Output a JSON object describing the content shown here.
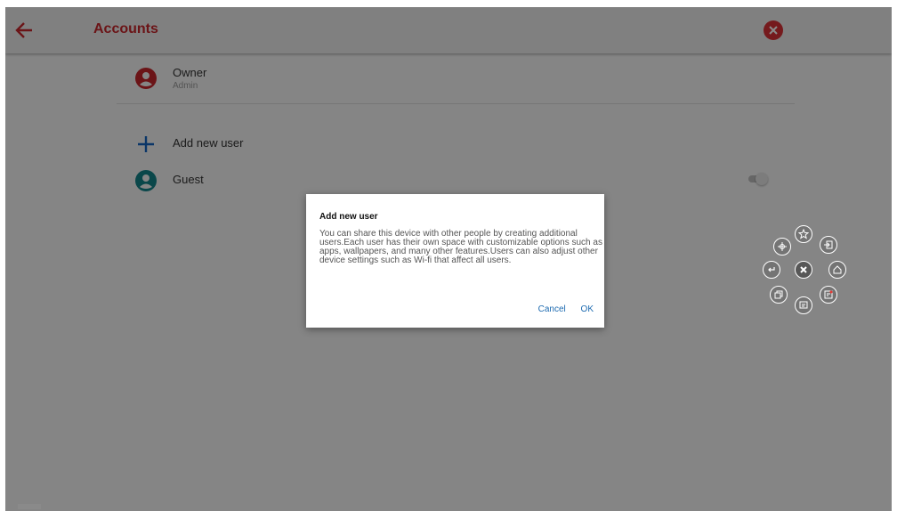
{
  "appbar": {
    "title": "Accounts",
    "back_icon": "arrow-left-icon",
    "close_icon": "close-circle-icon"
  },
  "users": {
    "owner": {
      "name": "Owner",
      "role": "Admin",
      "icon": "account-circle-icon"
    },
    "add": {
      "label": "Add new user",
      "icon": "plus-icon"
    },
    "guest": {
      "name": "Guest",
      "icon": "account-circle-icon",
      "toggle_on": false
    }
  },
  "dialog": {
    "title": "Add new user",
    "body": "You can share this device with other people by creating additional users.Each user has their own space with customizable options such as apps, wallpapers, and many other features.Users can also adjust other device settings such as Wi-fi that affect all users.",
    "cancel_label": "Cancel",
    "ok_label": "OK"
  },
  "floating_menu": {
    "icons": [
      "star-icon",
      "exit-icon",
      "home-icon",
      "note-icon",
      "comment-icon",
      "window-icon",
      "back-icon",
      "crosshair-icon",
      "close-icon"
    ]
  },
  "colors": {
    "accent": "#c6262c",
    "close_badge": "#d93137",
    "owner_avatar": "#c6262c",
    "add_icon": "#1565c0",
    "guest_avatar": "#14838a",
    "dialog_action": "#1c6ab0"
  }
}
